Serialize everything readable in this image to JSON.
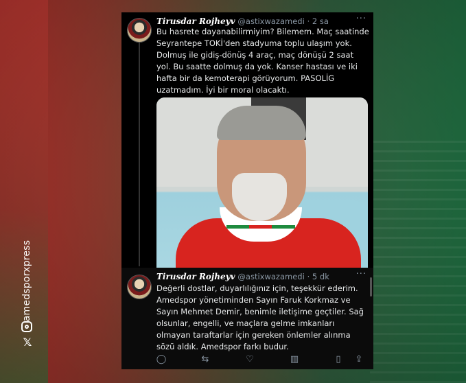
{
  "social": {
    "handle": "amedsporxpress",
    "icons": [
      "instagram-icon",
      "x-logo-icon"
    ]
  },
  "tweets": [
    {
      "name": "𝑻𝒊𝒓𝒖𝒔𝒅𝒂𝒓 𝑹𝒐𝒋𝒉𝒆𝒚𝒗",
      "handle": "@astixwazamedi",
      "time": "· 2 sa",
      "text": "Bu hasrete dayanabilirmiyim? Bilemem. Maç saatinde Seyrantepe TOKİ'den stadyuma toplu ulaşım yok. Dolmuş ile gidiş-dönüş 4 araç, maç dönüşü 2 saat yol. Bu saatte dolmuş da yok. Kanser hastası ve iki hafta bir da kemoterapi görüyorum. PASOLİG uzatmadım. İyi bir moral olacaktı."
    },
    {
      "name": "𝑻𝒊𝒓𝒖𝒔𝒅𝒂𝒓 𝑹𝒐𝒋𝒉𝒆𝒚𝒗",
      "handle": "@astixwazamedi",
      "time": "· 5 dk",
      "text": "Değerli dostlar, duyarlılığınız için, teşekkür ederim. Amedspor yönetiminden Sayın Faruk Korkmaz ve Sayın Mehmet Demir, benimle iletişime geçtiler. Sağ olsunlar, engelli, ve maçlara gelme imkanları olmayan taraftarlar için gereken önlemler alınma sözü aldık. Amedspor farkı budur."
    }
  ],
  "more_glyph": "···",
  "actions": {
    "reply": "◯",
    "retweet": "⇆",
    "like": "♡",
    "views": "▥",
    "bookmark": "▯",
    "share": "⇪"
  }
}
